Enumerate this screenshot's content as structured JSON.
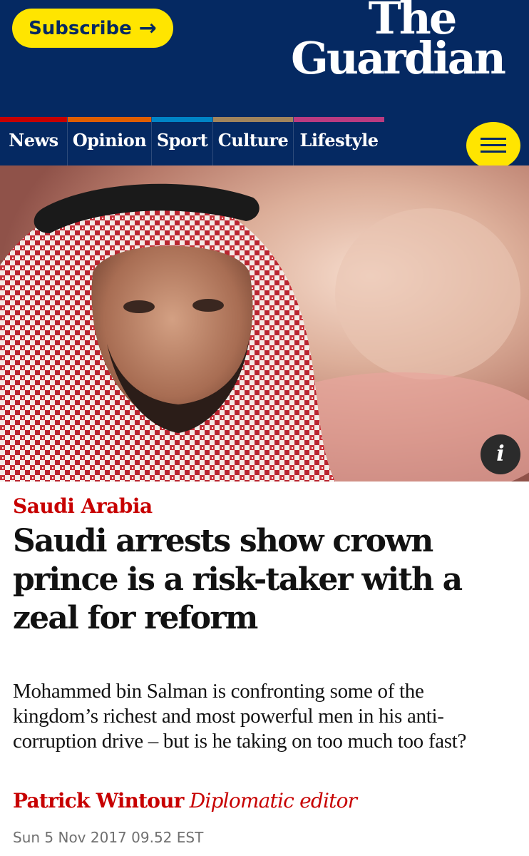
{
  "header": {
    "subscribe_label": "Subscribe",
    "subscribe_arrow": "→",
    "logo_line1": "The",
    "logo_line2": "Guardian",
    "pillars": [
      {
        "label": "News",
        "color": "#c70000"
      },
      {
        "label": "Opinion",
        "color": "#e05e00"
      },
      {
        "label": "Sport",
        "color": "#0084c6"
      },
      {
        "label": "Culture",
        "color": "#a1845c"
      },
      {
        "label": "Lifestyle",
        "color": "#bb3b80"
      }
    ],
    "menu_icon": "hamburger-menu-icon"
  },
  "hero": {
    "info_icon_label": "i"
  },
  "article": {
    "section": "Saudi Arabia",
    "headline": "Saudi arrests show crown prince is a risk-taker with a zeal for reform",
    "standfirst": "Mohammed bin Salman is confronting some of the kingdom’s richest and most powerful men in his anti-corruption drive – but is he taking on too much too fast?",
    "byline_name": "Patrick Wintour",
    "byline_role": "Diplomatic editor",
    "date": "Sun 5 Nov 2017 09.52 EST"
  },
  "colors": {
    "brand_blue": "#052962",
    "brand_yellow": "#ffe500",
    "news_red": "#c70000"
  }
}
